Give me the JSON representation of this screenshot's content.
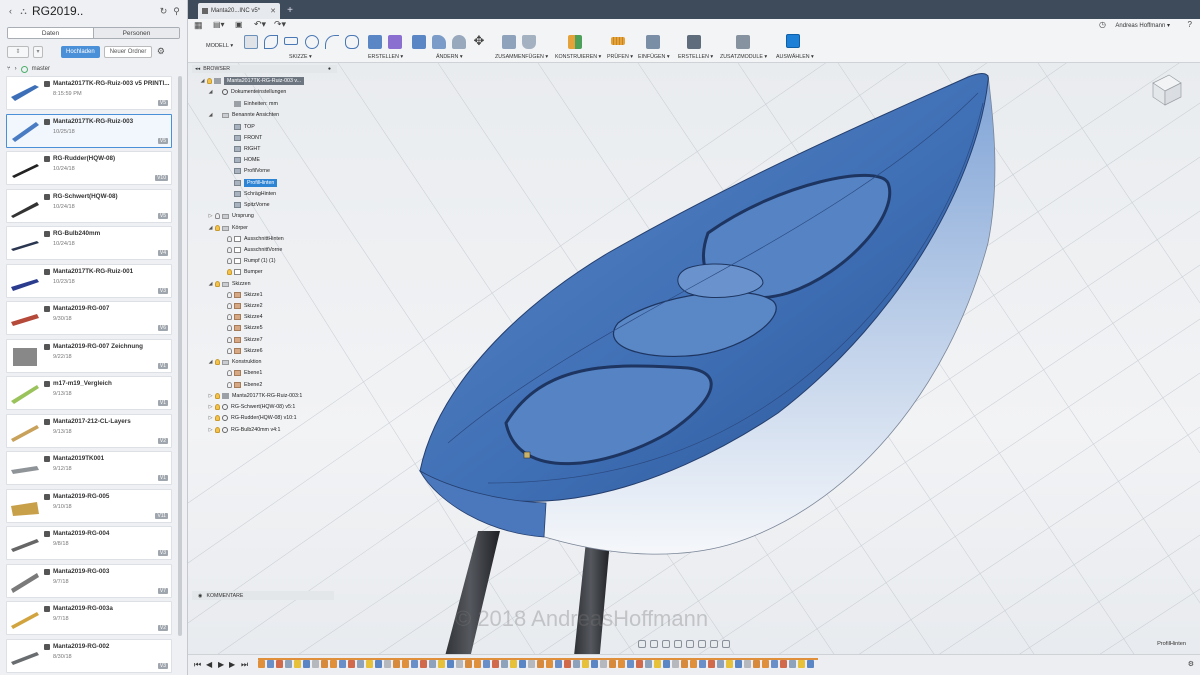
{
  "project": {
    "title": "RG2019.."
  },
  "data_panel": {
    "tabs": [
      "Daten",
      "Personen"
    ],
    "upload_button": "Hochladen",
    "new_folder_button": "Neuer Ordner",
    "branch": "master",
    "items": [
      {
        "name": "Manta2017TK-RG-Ruiz-003 v5 PRINTI...",
        "date": "8:15:59 PM",
        "version": "V5"
      },
      {
        "name": "Manta2017TK-RG-Ruiz-003",
        "date": "10/25/18",
        "version": "V5"
      },
      {
        "name": "RG-Rudder(HQW-08)",
        "date": "10/24/18",
        "version": "V10"
      },
      {
        "name": "RG-Schwert(HQW-08)",
        "date": "10/24/18",
        "version": "V5"
      },
      {
        "name": "RG-Bulb240mm",
        "date": "10/24/18",
        "version": "V4"
      },
      {
        "name": "Manta2017TK-RG-Ruiz-001",
        "date": "10/23/18",
        "version": "V3"
      },
      {
        "name": "Manta2019-RG-007",
        "date": "9/30/18",
        "version": "V6"
      },
      {
        "name": "Manta2019-RG-007 Zeichnung",
        "date": "9/22/18",
        "version": "V1"
      },
      {
        "name": "m17-m19_Vergleich",
        "date": "9/13/18",
        "version": "V1"
      },
      {
        "name": "Manta2017-212-CL-Layers",
        "date": "9/13/18",
        "version": "V2"
      },
      {
        "name": "Manta2019TK001",
        "date": "9/12/18",
        "version": "V1"
      },
      {
        "name": "Manta2019-RG-005",
        "date": "9/10/18",
        "version": "V11"
      },
      {
        "name": "Manta2019-RG-004",
        "date": "9/8/18",
        "version": "V3"
      },
      {
        "name": "Manta2019-RG-003",
        "date": "9/7/18",
        "version": "V7"
      },
      {
        "name": "Manta2019-RG-003a",
        "date": "9/7/18",
        "version": "V2"
      },
      {
        "name": "Manta2019-RG-002",
        "date": "8/30/18",
        "version": "V3"
      }
    ]
  },
  "doc_tab": {
    "title": "Manta20...INC v5*"
  },
  "user": {
    "name": "Andreas Hoffmann ▾"
  },
  "toolbar": {
    "workspace": "MODELL ▾",
    "groups": [
      "SKIZZE ▾",
      "ERSTELLEN ▾",
      "ÄNDERN ▾",
      "ZUSAMMENFÜGEN ▾",
      "KONSTRUIEREN ▾",
      "PRÜFEN ▾",
      "EINFÜGEN ▾",
      "ERSTELLEN ▾",
      "ZUSATZMODULE ▾",
      "AUSWÄHLEN ▾"
    ]
  },
  "browser": {
    "title": "BROWSER",
    "root": "Manta2017TK-RG-Ruiz-003 v...",
    "nodes": [
      {
        "label": "Dokumenteinstellungen",
        "icon": "gear-icon"
      },
      {
        "label": "Einheiten: mm",
        "icon": "doc-icon"
      },
      {
        "label": "Benannte Ansichten",
        "icon": "folder-icon"
      },
      {
        "label": "TOP",
        "icon": "view-icon"
      },
      {
        "label": "FRONT",
        "icon": "view-icon"
      },
      {
        "label": "RIGHT",
        "icon": "view-icon"
      },
      {
        "label": "HOME",
        "icon": "view-icon"
      },
      {
        "label": "ProfilVorne",
        "icon": "view-icon"
      },
      {
        "label": "ProfilHinten",
        "icon": "view-icon"
      },
      {
        "label": "SchrägHinten",
        "icon": "view-icon"
      },
      {
        "label": "SpitzVorne",
        "icon": "view-icon"
      },
      {
        "label": "Ursprung",
        "icon": "folder-icon"
      },
      {
        "label": "Körper",
        "icon": "folder-icon"
      },
      {
        "label": "AusschnittHinten",
        "icon": "body-icon"
      },
      {
        "label": "AusschnittVorne",
        "icon": "body-icon"
      },
      {
        "label": "Rumpf (1) (1)",
        "icon": "body-icon"
      },
      {
        "label": "Bumper",
        "icon": "body-icon"
      },
      {
        "label": "Skizzen",
        "icon": "folder-icon"
      },
      {
        "label": "Skizze1",
        "icon": "sketch-icon"
      },
      {
        "label": "Skizze2",
        "icon": "sketch-icon"
      },
      {
        "label": "Skizze4",
        "icon": "sketch-icon"
      },
      {
        "label": "Skizze5",
        "icon": "sketch-icon"
      },
      {
        "label": "Skizze7",
        "icon": "sketch-icon"
      },
      {
        "label": "Skizze6",
        "icon": "sketch-icon"
      },
      {
        "label": "Konstruktion",
        "icon": "folder-icon"
      },
      {
        "label": "Ebene1",
        "icon": "plane-icon"
      },
      {
        "label": "Ebene2",
        "icon": "plane-icon"
      },
      {
        "label": "Manta2017TK-RG-Ruiz-003:1",
        "icon": "component-icon"
      },
      {
        "label": "RG-Schwert(HQW-08) v5:1",
        "icon": "link-icon"
      },
      {
        "label": "RG-Rudder(HQW-08) v10:1",
        "icon": "link-icon"
      },
      {
        "label": "RG-Bulb240mm v4:1",
        "icon": "link-icon"
      }
    ]
  },
  "comments": {
    "title": "KOMMENTARE"
  },
  "viewport": {
    "current_view": "ProfilHinten",
    "watermark": "© 2018 AndreasHoffmann"
  },
  "colors": {
    "accent": "#2d83d4",
    "hull": "#3f6fb5",
    "tabbar": "#3e4b5a"
  }
}
